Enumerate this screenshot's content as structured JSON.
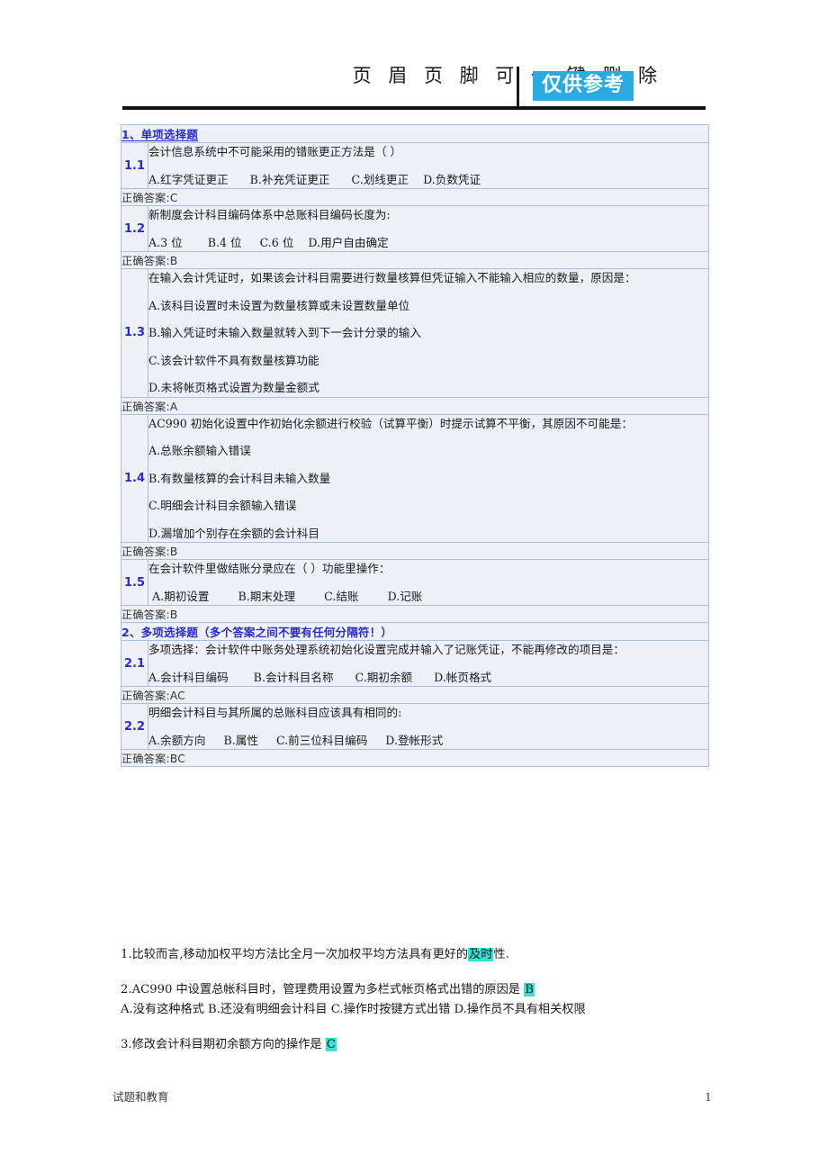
{
  "header": {
    "title": "页 眉 页 脚 可 一 键 删 除",
    "badge": "仅供参考"
  },
  "table": {
    "sections": [
      {
        "heading": "1、单项选择题",
        "underlined": true,
        "questions": [
          {
            "number": "1.1",
            "stem": "会计信息系统中不可能采用的错账更正方法是（ ）",
            "options_inline": "A.红字凭证更正      B.补充凭证更正      C.划线更正    D.负数凭证",
            "options_block": [],
            "answer": "正确答案:C"
          },
          {
            "number": "1.2",
            "stem": "新制度会计科目编码体系中总账科目编码长度为:",
            "options_inline": "A.3 位       B.4 位     C.6 位    D.用户自由确定",
            "options_block": [],
            "answer": "正确答案:B"
          },
          {
            "number": "1.3",
            "stem": "在输入会计凭证时，如果该会计科目需要进行数量核算但凭证输入不能输入相应的数量，原因是：",
            "options_inline": "",
            "options_block": [
              "A.该科目设置时未设置为数量核算或未设置数量单位",
              "B.输入凭证时未输入数量就转入到下一会计分录的输入",
              "C.该会计软件不具有数量核算功能",
              "D.未将帐页格式设置为数量金额式"
            ],
            "answer": "正确答案:A"
          },
          {
            "number": "1.4",
            "stem": "AC990 初始化设置中作初始化余额进行校验（试算平衡）时提示试算不平衡，其原因不可能是：",
            "options_inline": "",
            "options_block": [
              "A.总账余额输入错误",
              "B.有数量核算的会计科目未输入数量",
              "C.明细会计科目余额输入错误",
              "D.漏增加个别存在余额的会计科目"
            ],
            "answer": "正确答案:B"
          },
          {
            "number": "1.5",
            "stem": "在会计软件里做结账分录应在（     ）功能里操作：",
            "options_inline": " A.期初设置        B.期末处理        C.结账        D.记账",
            "options_block": [],
            "answer": "正确答案:B"
          }
        ]
      },
      {
        "heading": "2、多项选择题（多个答案之间不要有任何分隔符！）",
        "underlined": false,
        "questions": [
          {
            "number": "2.1",
            "stem": "多项选择：会计软件中账务处理系统初始化设置完成并输入了记账凭证，不能再修改的项目是：",
            "options_inline": "A.会计科目编码       B.会计科目名称      C.期初余额      D.帐页格式",
            "options_block": [],
            "answer": "正确答案:AC"
          },
          {
            "number": "2.2",
            "stem": "明细会计科目与其所属的总账科目应该具有相同的:",
            "options_inline": "A.余额方向     B.属性     C.前三位科目编码     D.登帐形式",
            "options_block": [],
            "answer": "正确答案:BC"
          }
        ]
      }
    ]
  },
  "free_text": {
    "item1": {
      "prefix": "1.比较而言,移动加权平均方法比全月一次加权平均方法具有更好的",
      "highlight": "及时",
      "suffix": "性."
    },
    "item2": {
      "line1_prefix": "2.AC990 中设置总帐科目时，管理费用设置为多栏式帐页格式出错的原因是 ",
      "line1_highlight": "B",
      "line2": "A.没有这种格式  B.还没有明细会计科目  C.操作时按键方式出错  D.操作员不具有相关权限"
    },
    "item3": {
      "prefix": "3.修改会计科目期初余额方向的操作是 ",
      "highlight": "C"
    }
  },
  "footer": {
    "label": "试题和教育",
    "page_number": "1"
  }
}
